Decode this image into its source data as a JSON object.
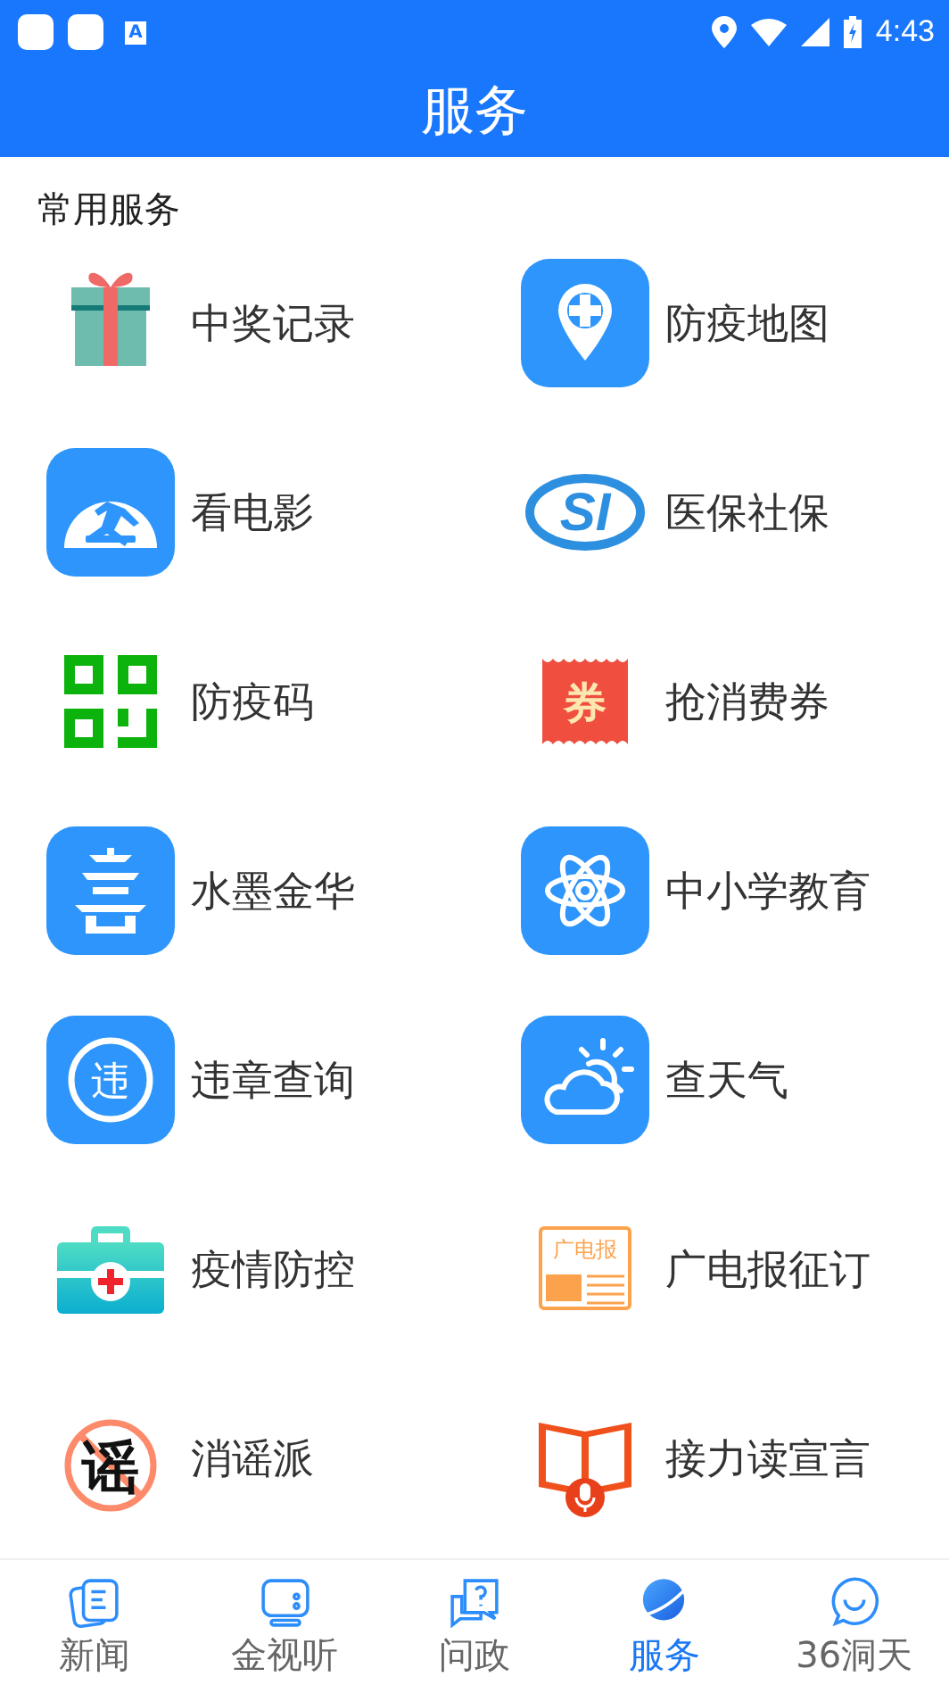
{
  "status_bar": {
    "app_badge": "A",
    "time": "4:43"
  },
  "header": {
    "title": "服务"
  },
  "section": {
    "title": "常用服务"
  },
  "services": [
    {
      "label": "中奖记录",
      "kind": "gift"
    },
    {
      "label": "防疫地图",
      "kind": "map-pin"
    },
    {
      "label": "看电影",
      "kind": "movie"
    },
    {
      "label": "医保社保",
      "kind": "si",
      "icon_text": "SI"
    },
    {
      "label": "防疫码",
      "kind": "qr"
    },
    {
      "label": "抢消费券",
      "kind": "ticket",
      "icon_text": "券"
    },
    {
      "label": "水墨金华",
      "kind": "pagoda"
    },
    {
      "label": "中小学教育",
      "kind": "atom"
    },
    {
      "label": "违章查询",
      "kind": "violation",
      "icon_text": "违"
    },
    {
      "label": "查天气",
      "kind": "weather"
    },
    {
      "label": "疫情防控",
      "kind": "medkit"
    },
    {
      "label": "广电报征订",
      "kind": "newspaper",
      "icon_text": "广电报"
    },
    {
      "label": "消谣派",
      "kind": "no-rumor",
      "icon_text": "谣"
    },
    {
      "label": "接力读宣言",
      "kind": "book-mic"
    }
  ],
  "tabs": [
    {
      "label": "新闻",
      "kind": "news",
      "selected": false
    },
    {
      "label": "金视听",
      "kind": "tv",
      "selected": false
    },
    {
      "label": "问政",
      "kind": "question",
      "selected": false
    },
    {
      "label": "服务",
      "kind": "planet",
      "selected": true
    },
    {
      "label": "36洞天",
      "kind": "chat",
      "selected": false
    }
  ]
}
